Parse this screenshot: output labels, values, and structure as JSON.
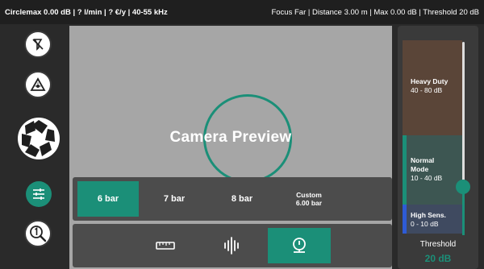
{
  "topbar": {
    "left": "Circlemax 0.00 dB | ? l/min | ? €/y | 40-55 kHz",
    "right": "Focus Far | Distance 3.00 m | Max 0.00 dB | Threshold 20 dB"
  },
  "leftbar": {
    "icons": [
      "no-focus-icon",
      "laser-warning-icon",
      "camera-aperture-icon",
      "sliders-settings-icon",
      "zoom-one-icon"
    ]
  },
  "preview": {
    "label": "Camera Preview"
  },
  "pressure": {
    "options": [
      {
        "label": "6 bar",
        "sub": "",
        "active": true
      },
      {
        "label": "7 bar",
        "sub": "",
        "active": false
      },
      {
        "label": "8 bar",
        "sub": "",
        "active": false
      },
      {
        "label": "Custom",
        "sub": "6.00 bar",
        "active": false
      }
    ]
  },
  "modes": {
    "icons": [
      "ruler-icon",
      "vibration-icon",
      "sensor-icon"
    ],
    "active_index": 2
  },
  "threshold_panel": {
    "zones": [
      {
        "title": "Heavy Duty",
        "range": "40 - 80 dB",
        "color": "#c0661a"
      },
      {
        "title": "Normal",
        "title2": "Mode",
        "range": "10 - 40 dB",
        "color": "#1b8f78"
      },
      {
        "title": "High Sens.",
        "range": "0 - 10 dB",
        "color": "#2e5bd6"
      }
    ],
    "label": "Threshold",
    "value": "20 dB",
    "slider_fraction": 0.25
  },
  "colors": {
    "accent": "#1b8f78"
  }
}
